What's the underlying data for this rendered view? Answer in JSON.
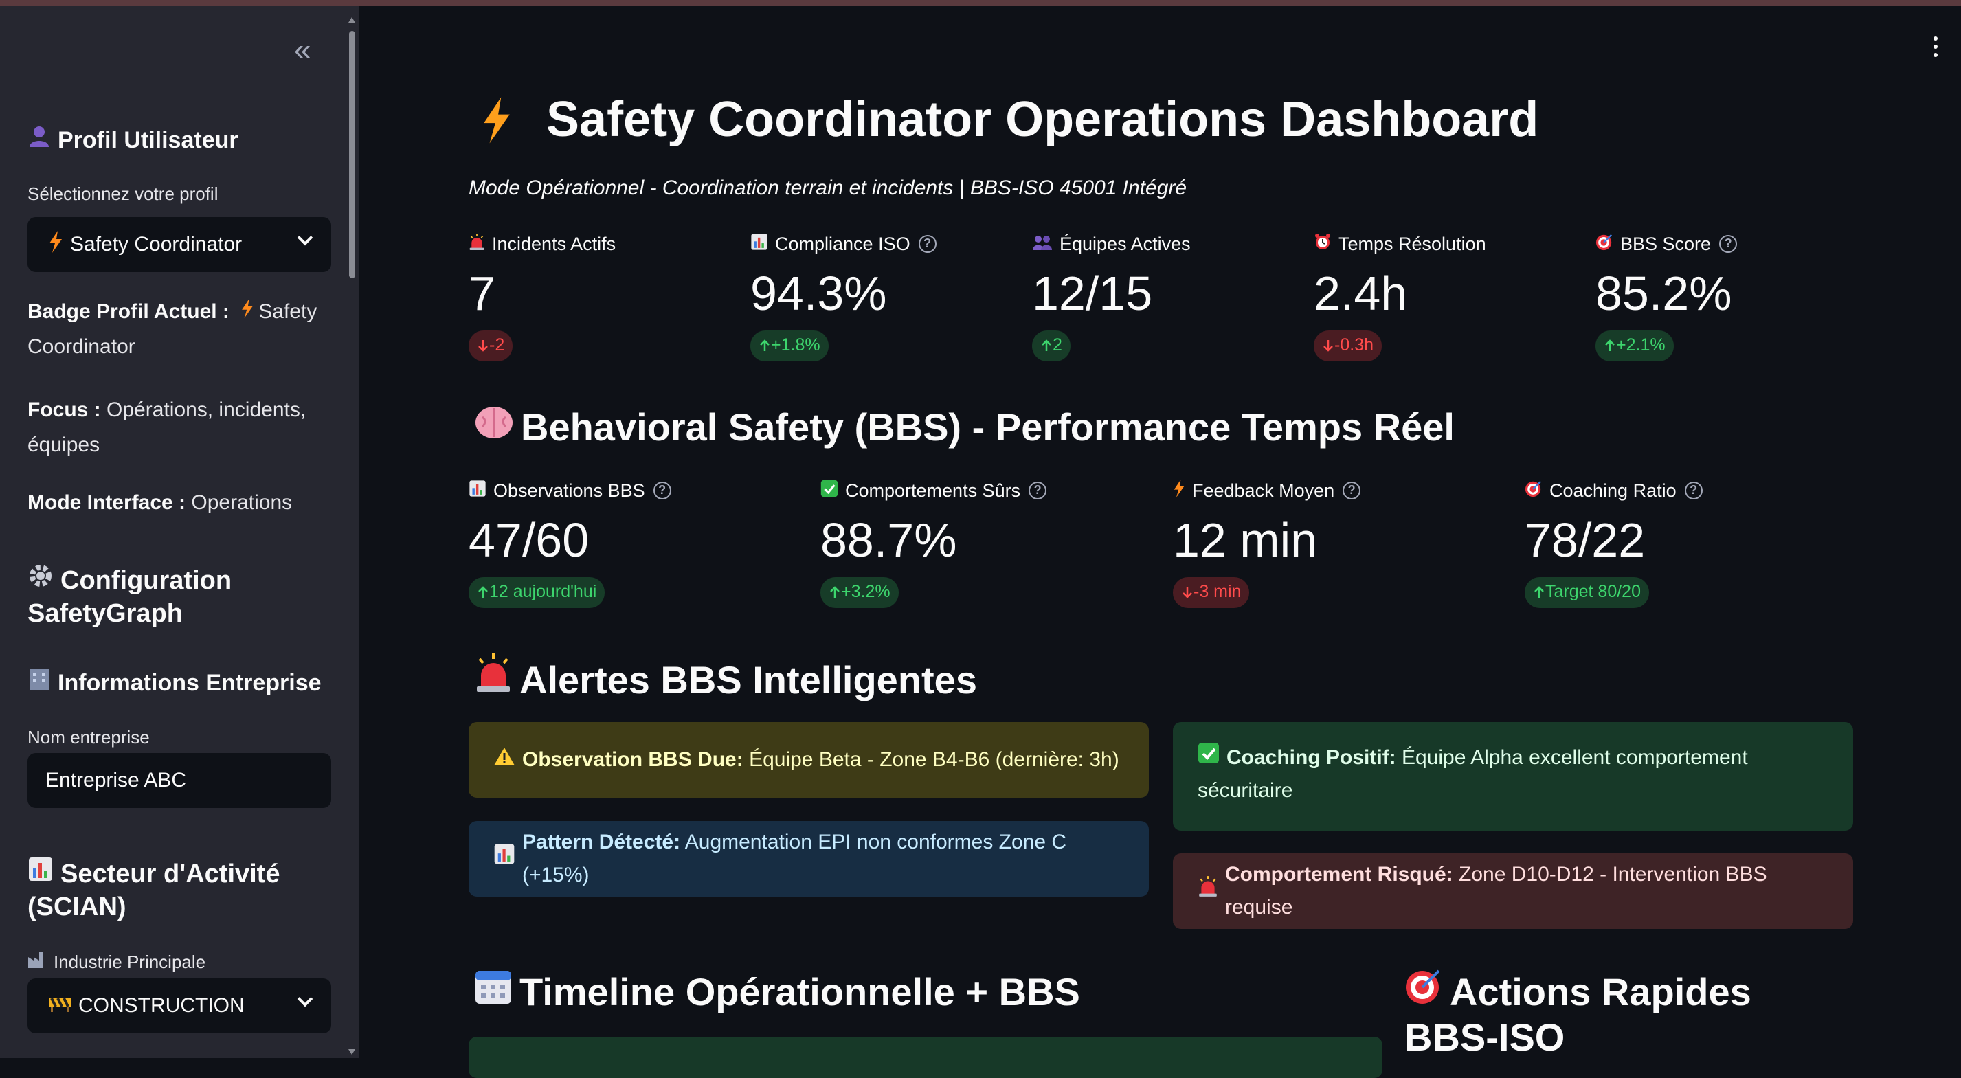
{
  "sidebar": {
    "profile_heading": "Profil Utilisateur",
    "profile_select_label": "Sélectionnez votre profil",
    "profile_selected": "Safety Coordinator",
    "badge_label": "Badge Profil Actuel :",
    "badge_value": "Safety Coordinator",
    "focus_label": "Focus :",
    "focus_value": "Opérations, incidents, équipes",
    "mode_label": "Mode Interface :",
    "mode_value": "Operations",
    "config_heading": "Configuration SafetyGraph",
    "company_heading": "Informations Entreprise",
    "company_name_label": "Nom entreprise",
    "company_name_value": "Entreprise ABC",
    "sector_heading": "Secteur d'Activité (SCIAN)",
    "industry_label": "Industrie Principale",
    "industry_selected": "CONSTRUCTION"
  },
  "header": {
    "title": "Safety Coordinator Operations Dashboard",
    "subtitle": "Mode Opérationnel - Coordination terrain et incidents | BBS-ISO 45001 Intégré"
  },
  "kpis": [
    {
      "label": "Incidents Actifs",
      "value": "7",
      "delta": "-2",
      "dir": "down",
      "icon": "siren-icon",
      "help": false
    },
    {
      "label": "Compliance ISO",
      "value": "94.3%",
      "delta": "+1.8%",
      "dir": "up",
      "icon": "chart-icon",
      "help": true
    },
    {
      "label": "Équipes Actives",
      "value": "12/15",
      "delta": "2",
      "dir": "up",
      "icon": "people-icon",
      "help": false
    },
    {
      "label": "Temps Résolution",
      "value": "2.4h",
      "delta": "-0.3h",
      "dir": "down",
      "icon": "alarm-clock-icon",
      "help": false
    },
    {
      "label": "BBS Score",
      "value": "85.2%",
      "delta": "+2.1%",
      "dir": "up",
      "icon": "target-icon",
      "help": true
    }
  ],
  "bbs": {
    "heading": "Behavioral Safety (BBS) - Performance Temps Réel",
    "metrics": [
      {
        "label": "Observations BBS",
        "value": "47/60",
        "delta": "12 aujourd'hui",
        "dir": "up",
        "icon": "chart-icon"
      },
      {
        "label": "Comportements Sûrs",
        "value": "88.7%",
        "delta": "+3.2%",
        "dir": "up",
        "icon": "check-icon"
      },
      {
        "label": "Feedback Moyen",
        "value": "12 min",
        "delta": "-3 min",
        "dir": "down",
        "icon": "bolt-icon"
      },
      {
        "label": "Coaching Ratio",
        "value": "78/22",
        "delta": "Target 80/20",
        "dir": "up",
        "icon": "target-icon"
      }
    ]
  },
  "alerts": {
    "heading": "Alertes BBS Intelligentes",
    "items": [
      {
        "title": "Observation BBS Due:",
        "text": " Équipe Beta - Zone B4-B6 (dernière: 3h)"
      },
      {
        "title": "Coaching Positif:",
        "text": " Équipe Alpha excellent comportement sécuritaire"
      },
      {
        "title": "Pattern Détecté:",
        "text": " Augmentation EPI non conformes Zone C (+15%)"
      },
      {
        "title": "Comportement Risqué:",
        "text": " Zone D10-D12 - Intervention BBS requise"
      }
    ]
  },
  "timeline_heading": "Timeline Opérationnelle + BBS",
  "actions_heading": "Actions Rapides BBS-ISO",
  "colors": {
    "bg": "#0e1117",
    "sidebar": "#262730",
    "up": "#3dd56d",
    "down": "#ff4b4b",
    "accent_orange": "#ff9f1c"
  }
}
